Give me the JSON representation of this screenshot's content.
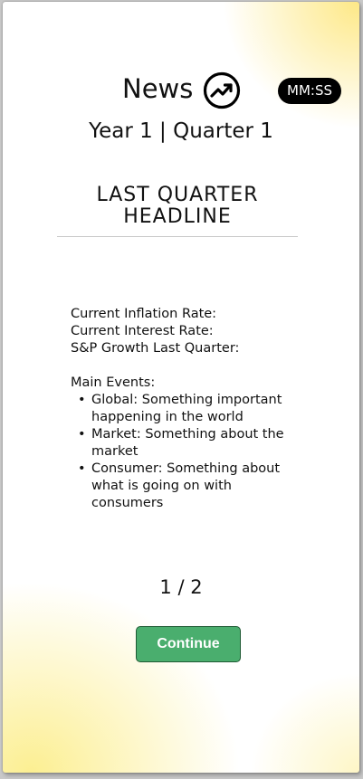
{
  "header": {
    "title": "News",
    "title_icon": "trending-up-icon",
    "timer": "MM:SS"
  },
  "subtitle": "Year 1 | Quarter 1",
  "headline": "LAST QUARTER\nHEADLINE",
  "stats": {
    "inflation_label": "Current Inflation Rate:",
    "interest_label": "Current Interest Rate:",
    "sp_growth_label": "S&P Growth Last Quarter:"
  },
  "events": {
    "title": "Main Events:",
    "items": [
      "Global: Something important happening in the world",
      "Market: Something about the market",
      "Consumer: Something about what is going on with consumers"
    ]
  },
  "pager": "1 / 2",
  "continue_label": "Continue",
  "colors": {
    "button": "#4aae6e",
    "accent_yellow": "#fde780"
  }
}
